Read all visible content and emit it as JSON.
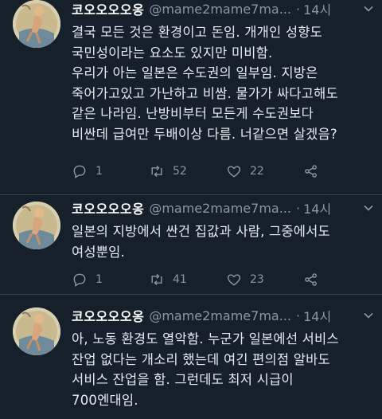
{
  "tweets": [
    {
      "name": "코오오오오옹",
      "handle": "@mame2mame7ma...",
      "sep": "·",
      "time": "14시",
      "text": "결국 모든 것은 환경이고 돈임. 개개인 성향도\n국민성이라는 요소도 있지만 미비함.\n우리가 아는 일본은 수도권의 일부임. 지방은\n죽어가고있고 가난하고 비쌈. 물가가 싸다고해도\n같은 나라임. 난방비부터 모든게 수도권보다\n비싼데 급여만 두배이상 다름. 너같으면 살겠음?",
      "replies": "1",
      "retweets": "52",
      "likes": "22"
    },
    {
      "name": "코오오오오옹",
      "handle": "@mame2mame7ma...",
      "sep": "·",
      "time": "14시",
      "text": "일본의 지방에서 싼건 집값과 사람, 그중에서도\n여성뿐임.",
      "replies": "1",
      "retweets": "41",
      "likes": "23"
    },
    {
      "name": "코오오오오옹",
      "handle": "@mame2mame7ma...",
      "sep": "·",
      "time": "14시",
      "text": "아, 노동 환경도 열악함. 누군가 일본에선 서비스\n잔업 없다는 개소리 했는데 여긴 편의점 알바도\n서비스 잔업을 함. 그런데도 최저 시급이\n700엔대임."
    }
  ],
  "colors": {
    "background": "#15202b",
    "text": "#e6ebef",
    "muted": "#8899a6",
    "divider": "#38444d"
  },
  "icons": {
    "reply": "reply-icon",
    "retweet": "retweet-icon",
    "like": "heart-icon",
    "share": "share-icon",
    "more": "chevron-down-icon"
  }
}
